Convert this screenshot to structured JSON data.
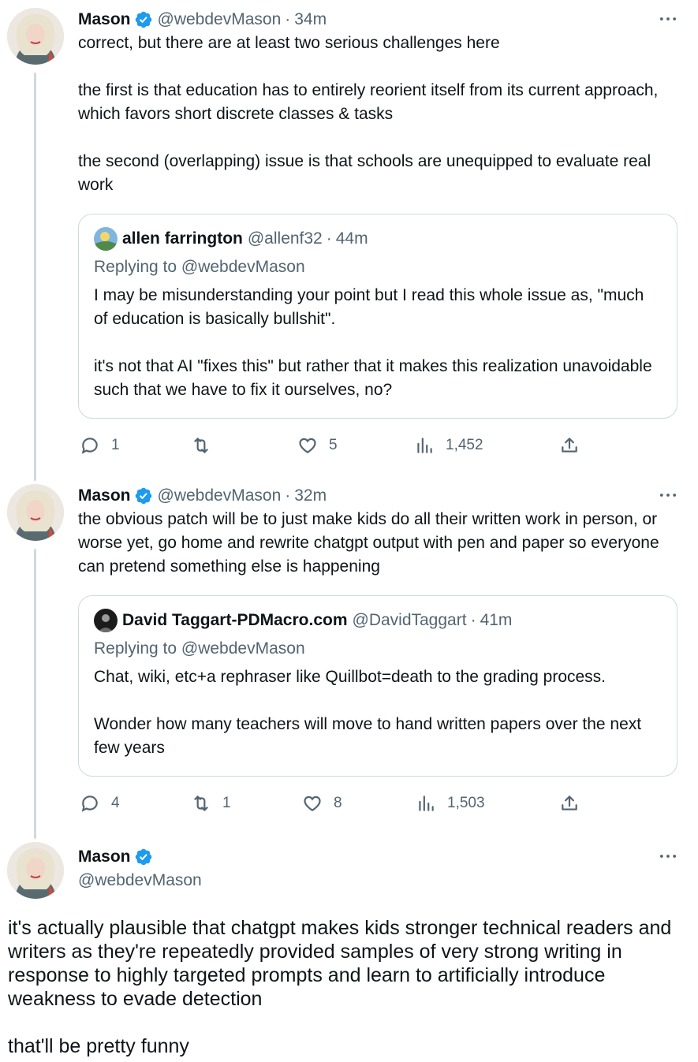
{
  "tweets": [
    {
      "name": "Mason",
      "handle": "@webdevMason",
      "time": "34m",
      "text": "correct, but there are at least two serious challenges here\n\nthe first is that education has to entirely reorient itself from its current approach, which favors short discrete classes & tasks\n\nthe second (overlapping) issue is that schools are unequipped to evaluate real work",
      "quote": {
        "name": "allen farrington",
        "handle": "@allenf32",
        "time": "44m",
        "replying": "Replying to @webdevMason",
        "text": "I may be misunderstanding your point but I read this whole issue as, \"much of education is basically bullshit\".\n\nit's not that AI \"fixes this\" but rather that it makes this realization unavoidable such that we have to fix it ourselves, no?"
      },
      "stats": {
        "replies": "1",
        "retweets": "",
        "likes": "5",
        "views": "1,452"
      }
    },
    {
      "name": "Mason",
      "handle": "@webdevMason",
      "time": "32m",
      "text": "the obvious patch will be to just make kids do all their written work in person, or worse yet, go home and rewrite chatgpt output with pen and paper so everyone can pretend something else is happening",
      "quote": {
        "name": "David Taggart-PDMacro.com",
        "handle": "@DavidTaggart",
        "time": "41m",
        "replying": "Replying to @webdevMason",
        "text": "Chat, wiki, etc+a rephraser like Quillbot=death to the grading process.\n\nWonder how many teachers will move to hand written papers over the next few years"
      },
      "stats": {
        "replies": "4",
        "retweets": "1",
        "likes": "8",
        "views": "1,503"
      }
    }
  ],
  "main": {
    "name": "Mason",
    "handle": "@webdevMason",
    "text": "it's actually plausible that chatgpt makes kids stronger technical readers and writers as they're repeatedly provided samples of very strong writing in response to highly targeted prompts and learn to artificially introduce weakness to evade detection\n\nthat'll be pretty funny"
  },
  "separator": "·",
  "colors": {
    "verified": "#1d9bf0",
    "secondary": "#536471",
    "border": "#cfd9de"
  }
}
